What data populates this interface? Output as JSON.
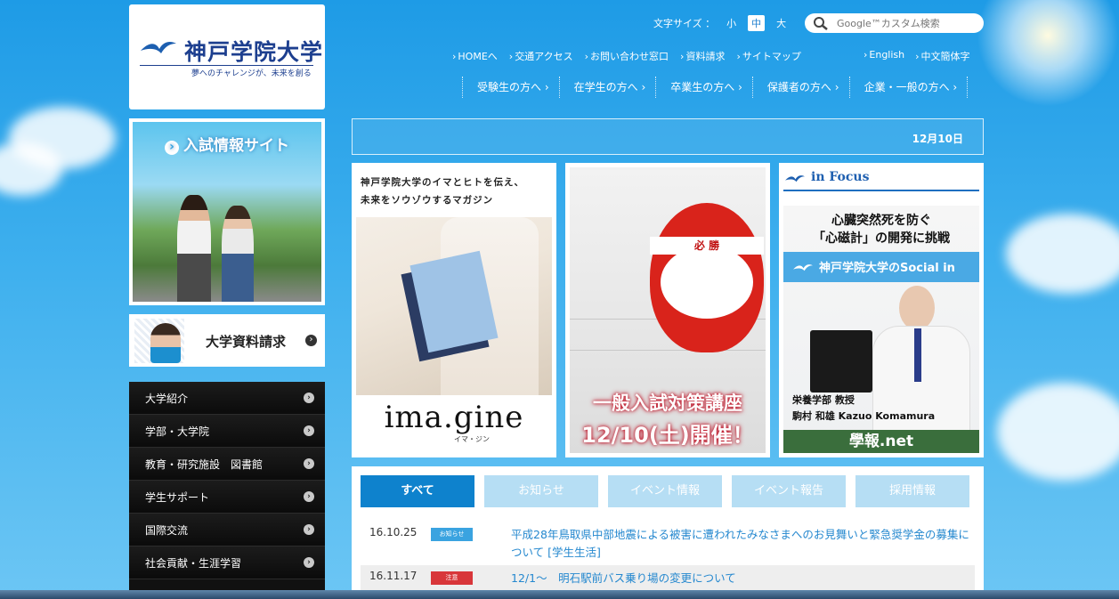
{
  "header": {
    "logo_name": "神戸学院大学",
    "logo_tagline": "夢へのチャレンジが、未来を創る",
    "font_size_label": "文字サイズ ：",
    "font_sizes": [
      "小",
      "中",
      "大"
    ],
    "search_placeholder": "Google™カスタム検索"
  },
  "util_nav": [
    "HOMEへ",
    "交通アクセス",
    "お問い合わせ窓口",
    "資料請求",
    "サイトマップ"
  ],
  "lang_nav": [
    "English",
    "中文簡体字"
  ],
  "main_nav": [
    "受験生の方へ",
    "在学生の方へ",
    "卒業生の方へ",
    "保護者の方へ",
    "企業・一般の方へ"
  ],
  "sidebar": {
    "nyushi_title": "入試情報サイト",
    "shiryo_label": "大学資料請求",
    "menu": [
      "大学紹介",
      "学部・大学院",
      "教育・研究施設　図書館",
      "学生サポート",
      "国際交流",
      "社会貢献・生涯学習"
    ]
  },
  "date_text": "12月10日",
  "panels": {
    "imagine_head_1": "神戸学院大学のイマとヒトを伝え、",
    "imagine_head_2": "未来をソウゾウするマガジン",
    "imagine_logo": "ima.gine",
    "imagine_sub": "イマ・ジン",
    "daruma_band": "必 勝",
    "exam_line1": "一般入試対策講座",
    "exam_line2": "12/10(土)開催！",
    "focus_title": "in Focus",
    "focus_h1": "心臓突然死を防ぐ",
    "focus_h2": "「心磁計」の開発に挑戦",
    "focus_band": "神戸学院大学のSocial in",
    "focus_role": "栄養学部 教授",
    "focus_name": "駒村 和雄 Kazuo Komamura",
    "focus_footer": "學報.net"
  },
  "news": {
    "tabs": [
      "すべて",
      "お知らせ",
      "イベント情報",
      "イベント報告",
      "採用情報"
    ],
    "items": [
      {
        "date": "16.10.25",
        "badge": "お知らせ",
        "badge_color": "#3aa3e0",
        "text": "平成28年鳥取県中部地震による被害に遭われたみなさまへのお見舞いと緊急奨学金の募集について [学生生活]"
      },
      {
        "date": "16.11.17",
        "badge": "注意",
        "badge_color": "#d8363a",
        "text": "12/1～　明石駅前バス乗り場の変更について"
      }
    ]
  },
  "colors": {
    "accent": "#0e82cd",
    "brand_navy": "#1d3f8f"
  }
}
